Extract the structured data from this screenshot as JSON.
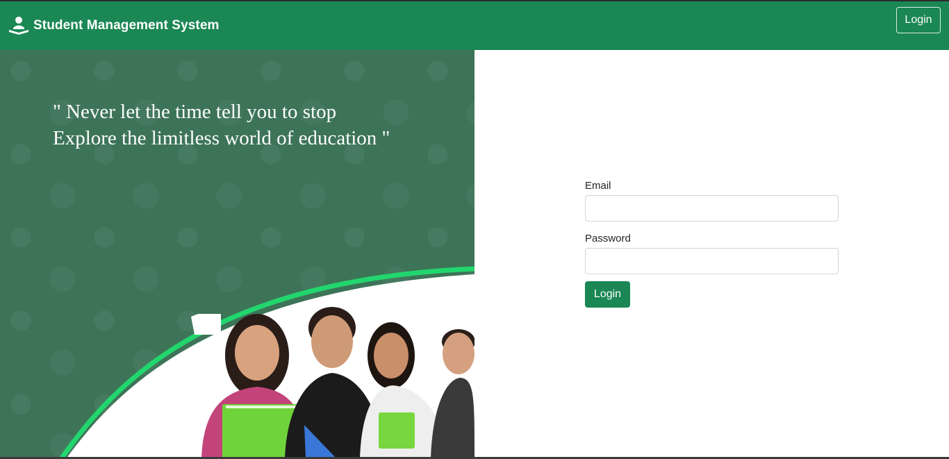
{
  "navbar": {
    "brand_icon": "reading-student-icon",
    "brand_title": "Student Management System",
    "login_label": "Login",
    "background_color": "#1a8754"
  },
  "hero": {
    "quote_line_1": "\" Never let the time tell you to stop",
    "quote_line_2": "Explore the limitless world of education \"",
    "image": "students-holding-notebooks-photo",
    "accent_color": "#22d66e"
  },
  "login_form": {
    "email_label": "Email",
    "email_value": "",
    "password_label": "Password",
    "password_value": "",
    "submit_label": "Login",
    "button_color": "#1a8754"
  }
}
